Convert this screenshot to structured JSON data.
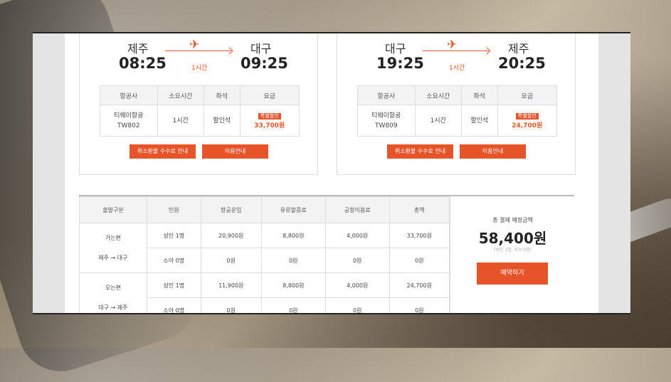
{
  "outbound": {
    "from_city": "제주",
    "to_city": "대구",
    "depart_time": "08:25",
    "arrive_time": "09:25",
    "duration": "1시간",
    "headers": [
      "항공사",
      "소요시간",
      "좌석",
      "요금"
    ],
    "airline_line1": "티웨이항공",
    "airline_line2": "TW802",
    "flight_time": "1시간",
    "seat": "할인석",
    "badge": "특별할인",
    "price": "33,700원",
    "btn_refund": "취소환불 수수료 안내",
    "btn_guide": "이용안내"
  },
  "inbound": {
    "from_city": "대구",
    "to_city": "제주",
    "depart_time": "19:25",
    "arrive_time": "20:25",
    "duration": "1시간",
    "headers": [
      "항공사",
      "소요시간",
      "좌석",
      "요금"
    ],
    "airline_line1": "티웨이항공",
    "airline_line2": "TW809",
    "flight_time": "1시간",
    "seat": "할인석",
    "badge": "특별할인",
    "price": "24,700원",
    "btn_refund": "취소환불 수수료 안내",
    "btn_guide": "이용안내"
  },
  "fare_table": {
    "headers": [
      "출발구분",
      "인원",
      "항공운임",
      "유류할증료",
      "공항이용료",
      "총액"
    ],
    "out_label": "가는편",
    "out_route": "제주 → 대구",
    "in_label": "오는편",
    "in_route": "대구 → 제주",
    "rows": [
      [
        "성인 1명",
        "20,900원",
        "8,800원",
        "4,000원",
        "33,700원"
      ],
      [
        "소아 0명",
        "0원",
        "0원",
        "0원",
        "0원"
      ],
      [
        "성인 1명",
        "11,900원",
        "8,800원",
        "4,000원",
        "24,700원"
      ],
      [
        "소아 0명",
        "0원",
        "0원",
        "0원",
        "0원"
      ]
    ]
  },
  "total": {
    "label": "총 결제 예정금액",
    "amount": "58,400원",
    "sub": "(성인 1명, 소아 0명)",
    "book_button": "예약하기"
  },
  "colors": {
    "accent": "#e8542a"
  }
}
